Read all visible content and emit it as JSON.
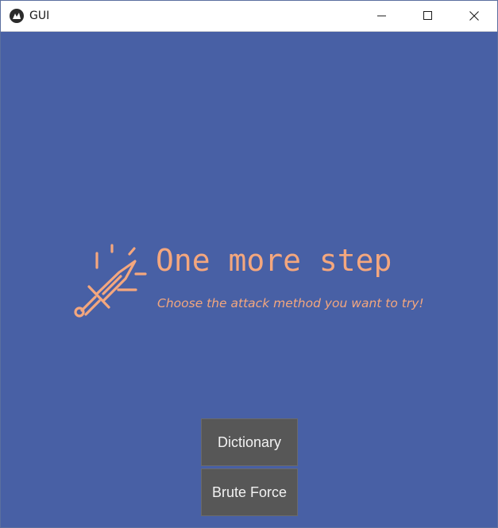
{
  "window": {
    "title": "GUI",
    "app_icon": "kivy-logo-icon",
    "controls": [
      "minimize-icon",
      "maximize-icon",
      "close-icon"
    ]
  },
  "main": {
    "icon": "sword-icon",
    "heading": "One more step",
    "subheading": "Choose the attack method you want to try!"
  },
  "buttons": {
    "dictionary_label": "Dictionary",
    "brute_force_label": "Brute Force"
  },
  "colors": {
    "background": "#4860a5",
    "accent": "#f4a77e",
    "button_bg": "#575757",
    "button_text": "#f2f2f2"
  }
}
